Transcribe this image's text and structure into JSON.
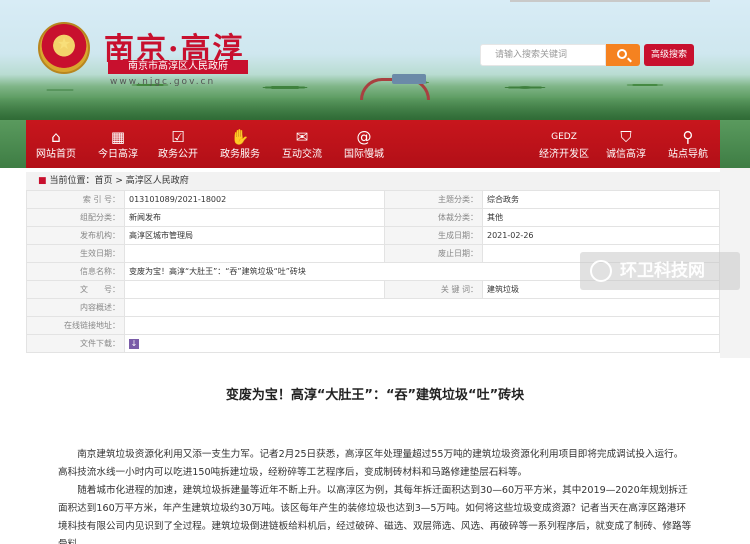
{
  "header": {
    "site_title": "南京·高淳",
    "site_subtitle": "南京市高淳区人民政府",
    "site_url": "www.njgc.gov.cn",
    "search_placeholder": "请输入搜索关键词",
    "advanced_search_label": "高级搜索"
  },
  "nav": {
    "items": [
      {
        "label": "网站首页",
        "icon": "home-icon"
      },
      {
        "label": "今日高淳",
        "icon": "calendar-icon"
      },
      {
        "label": "政务公开",
        "icon": "checklist-icon"
      },
      {
        "label": "政务服务",
        "icon": "handshake-icon"
      },
      {
        "label": "互动交流",
        "icon": "chat-icon"
      },
      {
        "label": "国际慢城",
        "icon": "snail-icon"
      },
      {
        "label": "经济开发区",
        "icon": "gedz-logo-icon"
      },
      {
        "label": "诚信高淳",
        "icon": "shield-icon"
      },
      {
        "label": "站点导航",
        "icon": "location-pin-icon"
      }
    ],
    "gedz_text": "GEDZ"
  },
  "breadcrumb": {
    "prefix": "当前位置：",
    "path": "首页 > 高淳区人民政府"
  },
  "info_table": {
    "index_label": "索 引 号：",
    "index_value": "013101089/2021-18002",
    "subject_label": "主题分类：",
    "subject_value": "综合政务",
    "org_label": "组配分类：",
    "org_value": "新闻发布",
    "genre_label": "体裁分类：",
    "genre_value": "其他",
    "publisher_label": "发布机构：",
    "publisher_value": "高淳区城市管理局",
    "created_label": "生成日期：",
    "created_value": "2021-02-26",
    "effective_label": "生效日期：",
    "effective_value": "",
    "abolish_label": "废止日期：",
    "abolish_value": "",
    "name_label": "信息名称：",
    "name_value": "变废为宝！高淳“大肚王”：“吞”建筑垃圾“吐”砖块",
    "docno_label": "文　　号：",
    "docno_value": "",
    "keywords_label": "关 键 词：",
    "keywords_value": "建筑垃圾",
    "summary_label": "内容概述：",
    "summary_value": "",
    "link_label": "在线链接地址：",
    "link_value": "",
    "download_label": "文件下载："
  },
  "watermark": {
    "text": "环卫科技网"
  },
  "article": {
    "title": "变废为宝！高淳“大肚王”：“吞”建筑垃圾“吐”砖块",
    "p1": "南京建筑垃圾资源化利用又添一支生力军。记者2月25日获悉，高淳区年处理量超过55万吨的建筑垃圾资源化利用项目即将完成调试投入运行。高科技流水线一小时内可以吃进150吨拆建垃圾，经粉碎等工艺程序后，变成制砖材料和马路修建垫层石料等。",
    "p2": "随着城市化进程的加速，建筑垃圾拆建量等近年不断上升。以高淳区为例，其每年拆迁面积达到30—60万平方米，其中2019—2020年规划拆迁面积达到160万平方米，年产生建筑垃圾约30万吨。该区每年产生的装修垃圾也达到3—5万吨。如何将这些垃圾变成资源？记者当天在高淳区路港环境科技有限公司内见识到了全过程。建筑垃圾倒进链板给料机后，经过破碎、磁选、双层筛选、风选、再破碎等一系列程序后，就变成了制砖、修路等骨料。"
  }
}
